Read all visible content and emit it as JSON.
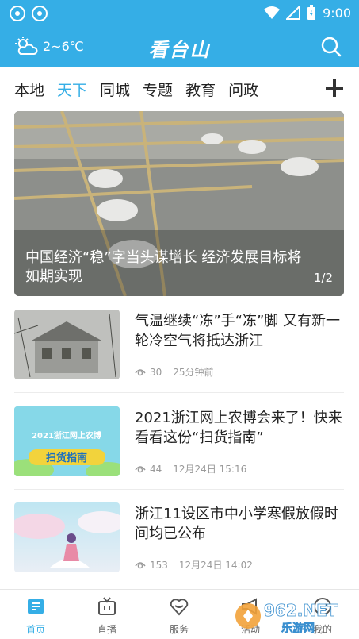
{
  "status_bar": {
    "time": "9:00"
  },
  "header": {
    "weather_temp": "2~6℃",
    "app_title": "看台山"
  },
  "tabs": [
    {
      "label": "本地",
      "active": false
    },
    {
      "label": "天下",
      "active": true
    },
    {
      "label": "同城",
      "active": false
    },
    {
      "label": "专题",
      "active": false
    },
    {
      "label": "教育",
      "active": false
    },
    {
      "label": "问政",
      "active": false
    }
  ],
  "banner": {
    "caption": "中国经济“稳”字当头谋增长 经济发展目标将如期实现",
    "pager": "1/2"
  },
  "news": [
    {
      "title": "气温继续“冻”手“冻”脚 又有新一轮冷空气将抵达浙江",
      "views": "30",
      "time": "25分钟前"
    },
    {
      "title": "2021浙江网上农博会来了！快来看看这份“扫货指南”",
      "views": "44",
      "time": "12月24日 15:16",
      "thumb_line1": "2021浙江网上农博",
      "thumb_line2": "扫货指南"
    },
    {
      "title": "浙江11设区市中小学寒假放假时间均已公布",
      "views": "153",
      "time": "12月24日 14:02"
    }
  ],
  "bottom_nav": [
    {
      "label": "首页",
      "icon": "home-icon",
      "active": true
    },
    {
      "label": "直播",
      "icon": "tv-icon",
      "active": false
    },
    {
      "label": "服务",
      "icon": "heart-icon",
      "active": false
    },
    {
      "label": "活动",
      "icon": "megaphone-icon",
      "active": false
    },
    {
      "label": "我的",
      "icon": "smile-icon",
      "active": false
    }
  ],
  "watermark": {
    "brand": "962.NET",
    "subtitle": "乐游网"
  },
  "colors": {
    "accent": "#35aee6"
  }
}
